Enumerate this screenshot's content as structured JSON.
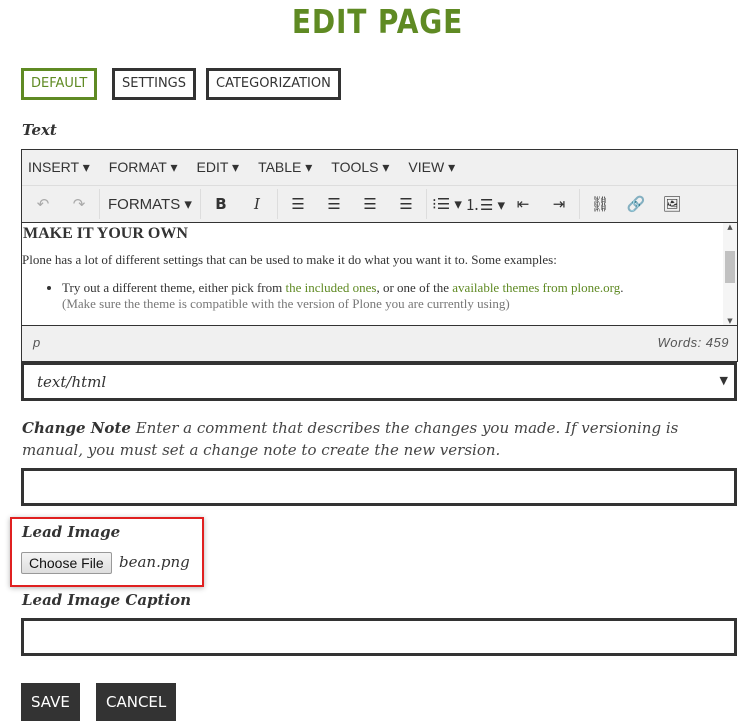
{
  "title": "EDIT PAGE",
  "tabs": [
    {
      "label": "DEFAULT",
      "active": true
    },
    {
      "label": "SETTINGS"
    },
    {
      "label": "CATEGORIZATION"
    }
  ],
  "text_label": "Text",
  "editor": {
    "menus": [
      "INSERT",
      "FORMAT",
      "EDIT",
      "TABLE",
      "TOOLS",
      "VIEW"
    ],
    "formats_label": "FORMATS",
    "heading": "MAKE IT YOUR OWN",
    "paragraph": "Plone has a lot of different settings that can be used to make it do what you want it to. Some examples:",
    "bullet_pre": "Try out a different theme, either pick from ",
    "link1": "the included ones",
    "bullet_mid": ", or one of the ",
    "link2": "available themes from plone.org",
    "bullet_end": ".",
    "note": "(Make sure the theme is compatible with the version of Plone you are currently using)",
    "path": "p",
    "word_count": "Words: 459"
  },
  "format_select": "text/html",
  "change_note": {
    "label": "Change Note",
    "help": "Enter a comment that describes the changes you made. If versioning is manual, you must set a change note to create the new version.",
    "value": ""
  },
  "lead_image": {
    "label": "Lead Image",
    "button": "Choose File",
    "filename": "bean.png"
  },
  "caption": {
    "label": "Lead Image Caption",
    "value": ""
  },
  "actions": {
    "save": "SAVE",
    "cancel": "CANCEL"
  },
  "colors": {
    "accent": "#5f8a23",
    "highlight": "#e02020"
  }
}
